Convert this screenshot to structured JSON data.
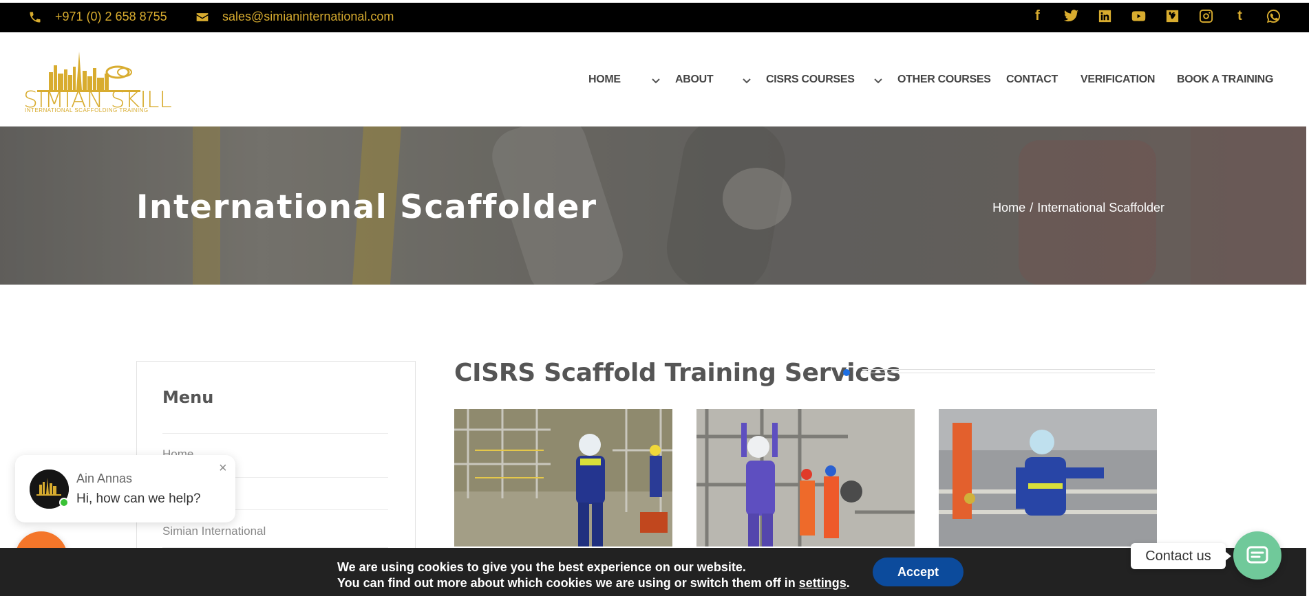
{
  "topbar": {
    "phone": "+971 (0) 2 658 8755",
    "email": "sales@simianinternational.com",
    "socials": [
      "facebook-icon",
      "twitter-icon",
      "linkedin-icon",
      "youtube-icon",
      "vimeo-icon",
      "instagram-icon",
      "tumblr-icon",
      "whatsapp-icon"
    ]
  },
  "logo": {
    "name": "SIMIAN SKILL",
    "tagline": "INTERNATIONAL SCAFFOLDING TRAINING"
  },
  "nav": {
    "home": "HOME",
    "about": "ABOUT",
    "cisrs_courses": "CISRS COURSES",
    "other_courses": "OTHER COURSES",
    "contact": "CONTACT",
    "verification": "VERIFICATION",
    "book": "BOOK A TRAINING"
  },
  "hero": {
    "title": "International Scaffolder",
    "breadcrumb_home": "Home",
    "breadcrumb_sep": "/",
    "breadcrumb_current": "International Scaffolder"
  },
  "sidebar": {
    "heading": "Menu",
    "items": [
      "Home",
      "",
      "Simian International"
    ]
  },
  "main": {
    "section_title": "CISRS Scaffold Training Services"
  },
  "chat": {
    "agent_name": "Ain Annas",
    "message": "Hi, how can we help?",
    "close": "×"
  },
  "cookie": {
    "line1": "We are using cookies to give you the best experience on our website.",
    "line2_prefix": "You can find out more about which cookies we are using or switch them off in ",
    "line2_link": "settings",
    "line2_suffix": ".",
    "accept": "Accept"
  },
  "contact_widget": {
    "label": "Contact us"
  },
  "colors": {
    "brand_gold": "#d8ac2f",
    "accept_blue": "#0c4b9c",
    "chat_orange": "#f4762a",
    "contact_green": "#70c99a",
    "title_dot_blue": "#1d6fe3"
  }
}
